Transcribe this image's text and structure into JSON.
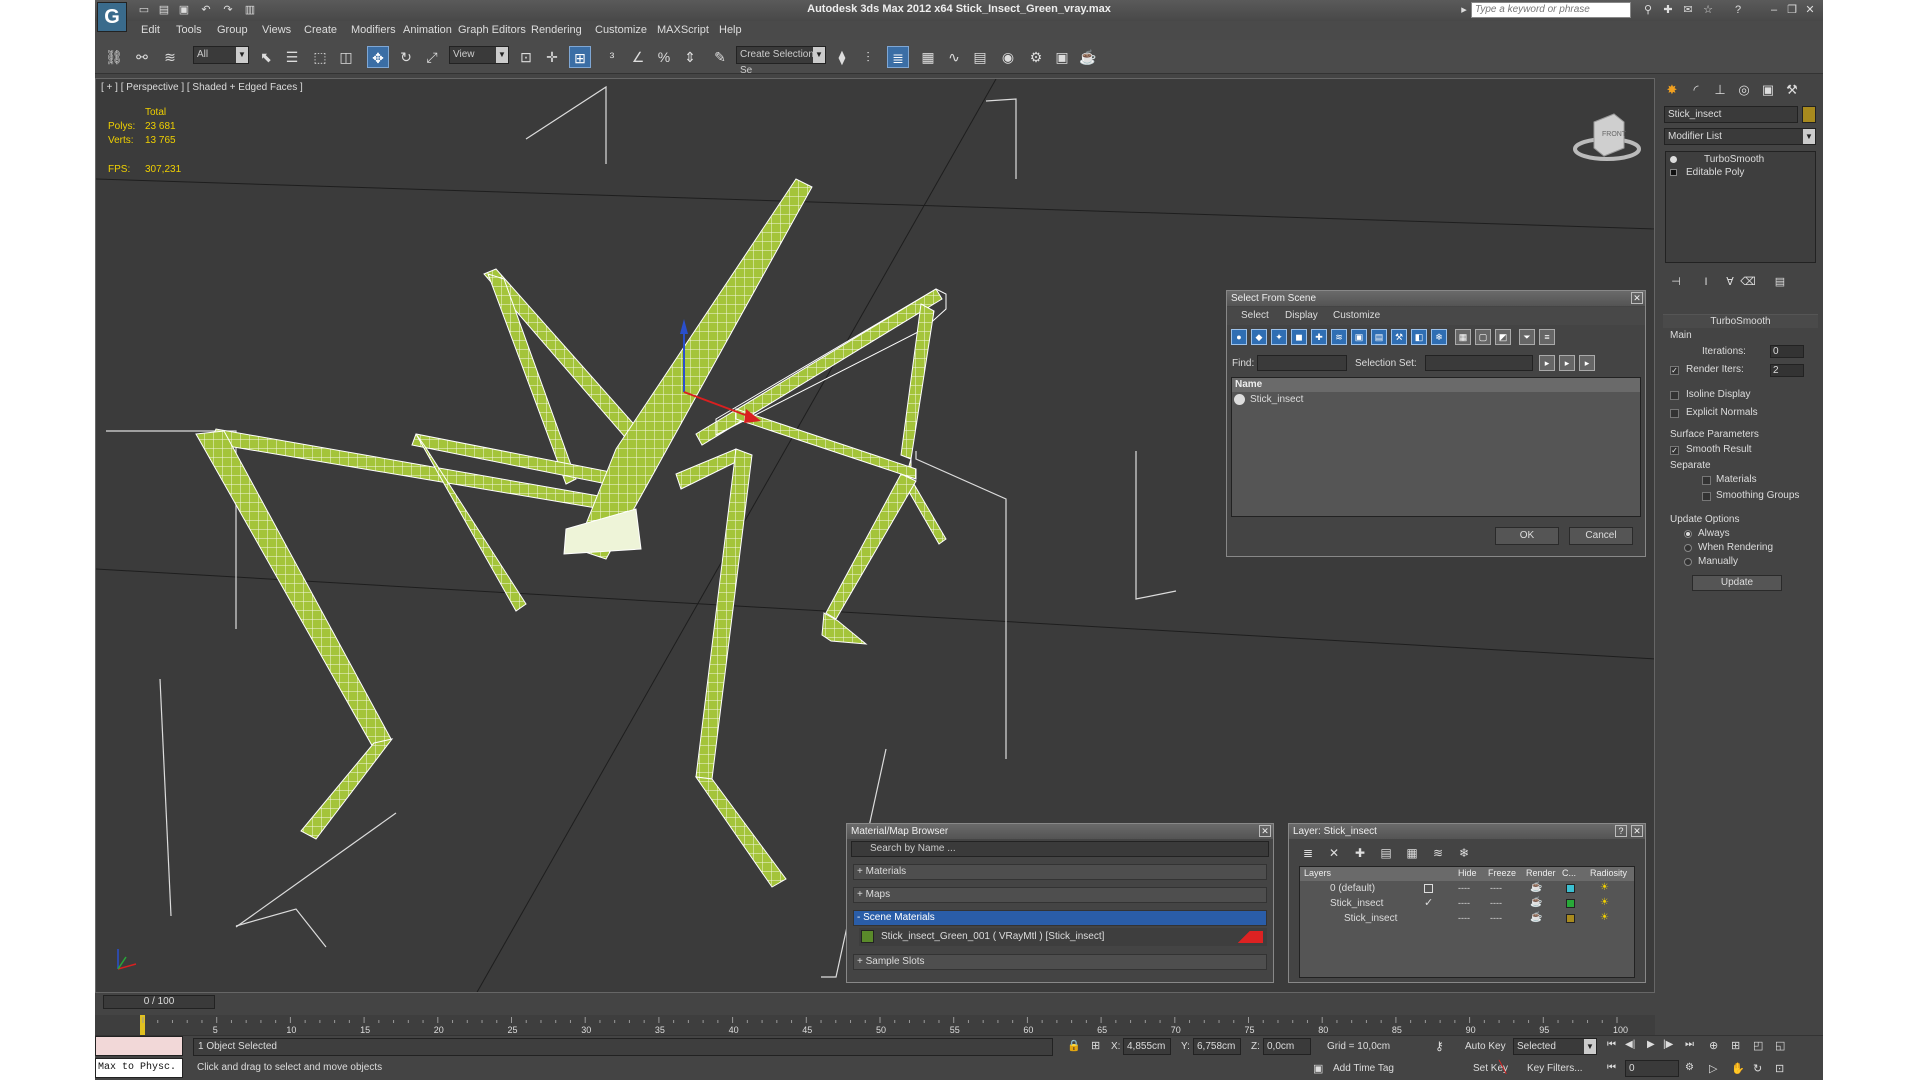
{
  "window": {
    "title": "Autodesk 3ds Max  2012 x64     Stick_Insect_Green_vray.max",
    "search_placeholder": "Type a keyword or phrase"
  },
  "menu": [
    "Edit",
    "Tools",
    "Group",
    "Views",
    "Create",
    "Modifiers",
    "Animation",
    "Graph Editors",
    "Rendering",
    "Customize",
    "MAXScript",
    "Help"
  ],
  "toolbar": {
    "selection_filter": "All",
    "reference_coord": "View",
    "named_selection_placeholder": "Create Selection Se"
  },
  "viewport": {
    "label": "[ + ] [ Perspective ] [ Shaded + Edged Faces ]",
    "stats": {
      "total_label": "Total",
      "polys_label": "Polys:",
      "polys_value": "23 681",
      "verts_label": "Verts:",
      "verts_value": "13 765",
      "fps_label": "FPS:",
      "fps_value": "307,231"
    },
    "viewcube_label": "FRONT"
  },
  "command_panel": {
    "object_name": "Stick_insect",
    "modifier_list": "Modifier List",
    "stack": [
      "TurboSmooth",
      "Editable Poly"
    ],
    "turbosmooth": {
      "title": "TurboSmooth",
      "main_label": "Main",
      "iterations_label": "Iterations:",
      "iterations_value": "0",
      "render_iters_label": "Render Iters:",
      "render_iters_value": "2",
      "isoline_label": "Isoline Display",
      "explicit_normals_label": "Explicit Normals",
      "surface_params_label": "Surface Parameters",
      "smooth_result_label": "Smooth Result",
      "separate_label": "Separate",
      "materials_label": "Materials",
      "smoothing_groups_label": "Smoothing Groups",
      "update_options_label": "Update Options",
      "always_label": "Always",
      "when_rendering_label": "When Rendering",
      "manually_label": "Manually",
      "update_button": "Update"
    }
  },
  "select_from_scene": {
    "title": "Select From Scene",
    "menu": [
      "Select",
      "Display",
      "Customize"
    ],
    "find_label": "Find:",
    "selection_set_label": "Selection Set:",
    "column_name": "Name",
    "items": [
      "Stick_insect"
    ],
    "ok": "OK",
    "cancel": "Cancel"
  },
  "material_browser": {
    "title": "Material/Map Browser",
    "search_placeholder": "Search by Name ...",
    "groups": [
      "+ Materials",
      "+ Maps",
      "- Scene Materials",
      "+ Sample Slots"
    ],
    "scene_material": "Stick_insect_Green_001  ( VRayMtl )  [Stick_insect]"
  },
  "layer_manager": {
    "title": "Layer: Stick_insect",
    "columns": [
      "Layers",
      "Hide",
      "Freeze",
      "Render",
      "C...",
      "Radiosity"
    ],
    "rows": [
      {
        "name": "0 (default)",
        "color": "#3bbfd1"
      },
      {
        "name": "Stick_insect",
        "color": "#28a838"
      },
      {
        "name": "Stick_insect",
        "color": "#a88a1e"
      }
    ]
  },
  "timeline": {
    "frame": "0 / 100",
    "ticks": [
      "5",
      "10",
      "15",
      "20",
      "25",
      "30",
      "35",
      "40",
      "45",
      "50",
      "55",
      "60",
      "65",
      "70",
      "75",
      "80",
      "85",
      "90",
      "95",
      "100"
    ]
  },
  "status": {
    "script_label": "Max to Physc.",
    "selected_text": "1 Object Selected",
    "prompt_text": "Click and drag to select and move objects",
    "x_label": "X:",
    "x_value": "4,855cm",
    "y_label": "Y:",
    "y_value": "6,758cm",
    "z_label": "Z:",
    "z_value": "0,0cm",
    "grid": "Grid = 10,0cm",
    "add_time_tag": "Add Time Tag",
    "auto_key": "Auto Key",
    "set_key": "Set Key",
    "key_mode": "Selected",
    "key_filters": "Key Filters...",
    "frame_value": "0"
  },
  "colors": {
    "insect_green": "#a8c83a",
    "selection_blue": "#2a5da8",
    "stats_yellow": "#f0d000"
  }
}
